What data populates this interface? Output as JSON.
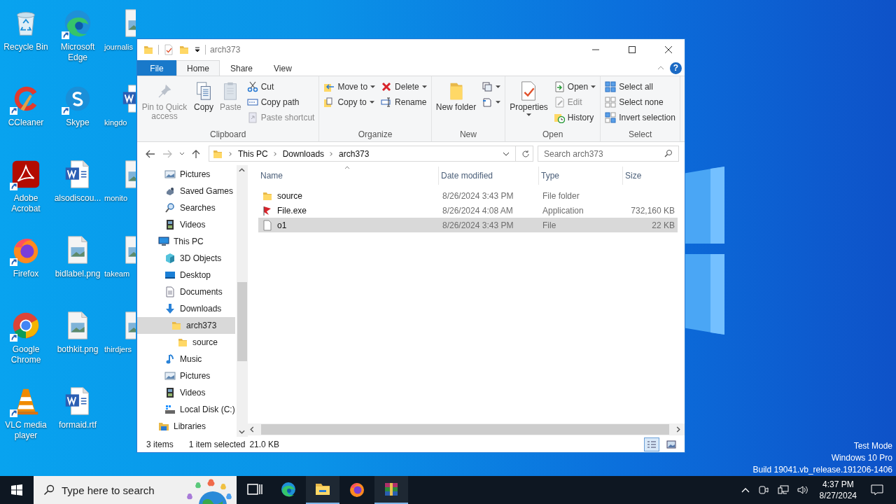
{
  "desktop": {
    "icons": [
      {
        "label": "Recycle Bin",
        "kind": "recycle",
        "shortcut": false
      },
      {
        "label": "Microsoft Edge",
        "kind": "edge",
        "shortcut": true
      },
      {
        "label": "journalis",
        "kind": "image",
        "shortcut": false
      },
      {
        "label": "CCleaner",
        "kind": "ccleaner",
        "shortcut": true
      },
      {
        "label": "Skype",
        "kind": "skype",
        "shortcut": true
      },
      {
        "label": "kingdo",
        "kind": "word",
        "shortcut": false
      },
      {
        "label": "Adobe Acrobat",
        "kind": "acrobat",
        "shortcut": true
      },
      {
        "label": "alsodiscou...",
        "kind": "word",
        "shortcut": false
      },
      {
        "label": "monito",
        "kind": "image",
        "shortcut": false
      },
      {
        "label": "Firefox",
        "kind": "firefox",
        "shortcut": true
      },
      {
        "label": "bidlabel.png",
        "kind": "image",
        "shortcut": false
      },
      {
        "label": "takeam",
        "kind": "image",
        "shortcut": false
      },
      {
        "label": "Google Chrome",
        "kind": "chrome",
        "shortcut": true
      },
      {
        "label": "bothkit.png",
        "kind": "image",
        "shortcut": false
      },
      {
        "label": "thirdjers",
        "kind": "image",
        "shortcut": false
      },
      {
        "label": "VLC media player",
        "kind": "vlc",
        "shortcut": true
      },
      {
        "label": "formaid.rtf",
        "kind": "word",
        "shortcut": false
      }
    ]
  },
  "system_info": [
    "Test Mode",
    "Windows 10 Pro",
    "Build 19041.vb_release.191206-1406"
  ],
  "window": {
    "title": "arch373",
    "tabs": [
      {
        "label": "File",
        "kind": "file",
        "selected": false
      },
      {
        "label": "Home",
        "kind": "tab",
        "selected": true
      },
      {
        "label": "Share",
        "kind": "tab",
        "selected": false
      },
      {
        "label": "View",
        "kind": "tab",
        "selected": false
      }
    ],
    "help": "?",
    "ribbon": [
      {
        "label": "Clipboard",
        "large": [
          {
            "label": "Pin to Quick access",
            "disabled": true,
            "dropdown": false
          },
          {
            "label": "Copy",
            "disabled": false,
            "dropdown": false
          },
          {
            "label": "Paste",
            "disabled": true,
            "dropdown": false
          }
        ],
        "columns": [
          [
            {
              "label": "Cut",
              "disabled": false,
              "dropdown": false
            },
            {
              "label": "Copy path",
              "disabled": false,
              "dropdown": false
            },
            {
              "label": "Paste shortcut",
              "disabled": true,
              "dropdown": false
            }
          ]
        ]
      },
      {
        "label": "Organize",
        "columns": [
          [
            {
              "label": "Move to",
              "disabled": false,
              "dropdown": true
            },
            {
              "label": "Copy to",
              "disabled": false,
              "dropdown": true
            }
          ],
          [
            {
              "label": "Delete",
              "disabled": false,
              "dropdown": true
            },
            {
              "label": "Rename",
              "disabled": false,
              "dropdown": false
            }
          ]
        ]
      },
      {
        "label": "New",
        "large": [
          {
            "label": "New folder",
            "disabled": false,
            "dropdown": false
          }
        ],
        "columns": [
          [
            {
              "disabled": false,
              "dropdown": true
            },
            {
              "disabled": false,
              "dropdown": true
            }
          ]
        ]
      },
      {
        "label": "Open",
        "large": [
          {
            "label": "Properties",
            "disabled": false,
            "dropdown": true
          }
        ],
        "columns": [
          [
            {
              "label": "Open",
              "disabled": false,
              "dropdown": true
            },
            {
              "label": "Edit",
              "disabled": true,
              "dropdown": false
            },
            {
              "label": "History",
              "disabled": false,
              "dropdown": false
            }
          ]
        ]
      },
      {
        "label": "Select",
        "columns": [
          [
            {
              "label": "Select all",
              "disabled": false,
              "dropdown": false
            },
            {
              "label": "Select none",
              "disabled": false,
              "dropdown": false
            },
            {
              "label": "Invert selection",
              "disabled": false,
              "dropdown": false
            }
          ]
        ]
      }
    ],
    "address": {
      "crumbs": [
        "This PC",
        "Downloads",
        "arch373"
      ]
    },
    "search": {
      "placeholder": "Search arch373"
    },
    "nav": {
      "above": [
        {
          "label": "Pictures",
          "kind": "pictures",
          "selected": false
        },
        {
          "label": "Saved Games",
          "kind": "games",
          "selected": false
        },
        {
          "label": "Searches",
          "kind": "search",
          "selected": false
        },
        {
          "label": "Videos",
          "kind": "videos",
          "selected": false
        }
      ],
      "items": [
        {
          "label": "This PC",
          "kind": "pc",
          "selected": false,
          "children": [
            {
              "label": "3D Objects",
              "kind": "cube",
              "selected": false
            },
            {
              "label": "Desktop",
              "kind": "desktop",
              "selected": false
            },
            {
              "label": "Documents",
              "kind": "documents",
              "selected": false
            },
            {
              "label": "Downloads",
              "kind": "downloads",
              "selected": false,
              "children": [
                {
                  "label": "arch373",
                  "kind": "folder",
                  "selected": true,
                  "children": [
                    {
                      "label": "source",
                      "kind": "folder",
                      "selected": false
                    }
                  ]
                }
              ]
            },
            {
              "label": "Music",
              "kind": "music",
              "selected": false
            },
            {
              "label": "Pictures",
              "kind": "pictures",
              "selected": false
            },
            {
              "label": "Videos",
              "kind": "videos",
              "selected": false
            },
            {
              "label": "Local Disk (C:)",
              "kind": "disk",
              "selected": false
            }
          ]
        },
        {
          "label": "Libraries",
          "kind": "libraries",
          "selected": false
        }
      ]
    },
    "columns": [
      "Name",
      "Date modified",
      "Type",
      "Size"
    ],
    "files": [
      {
        "name": "source",
        "kind": "folder",
        "date": "8/26/2024 3:43 PM",
        "type": "File folder",
        "selected": false
      },
      {
        "name": "File.exe",
        "kind": "app",
        "date": "8/26/2024 4:08 AM",
        "type": "Application",
        "size": "732,160 KB",
        "selected": false
      },
      {
        "name": "o1",
        "kind": "file",
        "date": "8/26/2024 3:43 PM",
        "type": "File",
        "size": "22 KB",
        "selected": true
      }
    ],
    "status": {
      "count": "3 items",
      "selection": "1 item selected",
      "selection_size": "21.0 KB"
    },
    "views": [
      {
        "kind": "details",
        "selected": true
      },
      {
        "kind": "tiles",
        "selected": false
      }
    ]
  },
  "taskbar": {
    "search_placeholder": "Type here to search",
    "apps": [
      {
        "kind": "taskview",
        "active": false
      },
      {
        "kind": "edge",
        "active": false
      },
      {
        "kind": "explorer",
        "active": true
      },
      {
        "kind": "firefox",
        "active": false
      },
      {
        "kind": "archive",
        "active": true
      }
    ],
    "time": "4:37 PM",
    "date": "8/27/2024"
  }
}
